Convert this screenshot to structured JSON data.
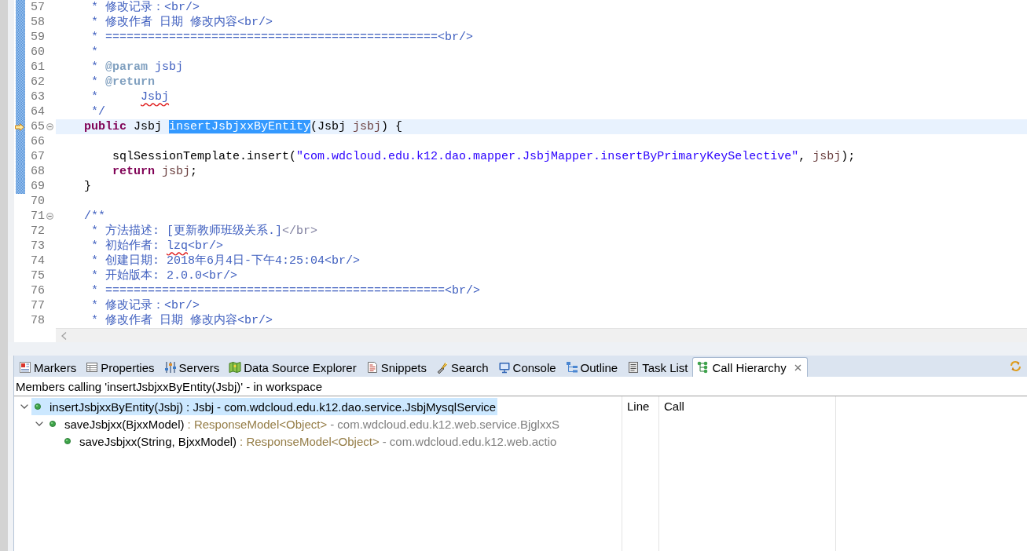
{
  "editor": {
    "lines": [
      {
        "number": "57",
        "changed": true,
        "current": false,
        "fold": false,
        "pointer": false,
        "segments": [
          {
            "kind": "comment",
            "text": "     * 修改记录：<br/>"
          }
        ]
      },
      {
        "number": "58",
        "changed": true,
        "current": false,
        "fold": false,
        "pointer": false,
        "segments": [
          {
            "kind": "comment",
            "text": "     * 修改作者 日期 修改内容<br/>"
          }
        ]
      },
      {
        "number": "59",
        "changed": true,
        "current": false,
        "fold": false,
        "pointer": false,
        "segments": [
          {
            "kind": "comment",
            "text": "     * ===============================================<br/>"
          }
        ]
      },
      {
        "number": "60",
        "changed": true,
        "current": false,
        "fold": false,
        "pointer": false,
        "segments": [
          {
            "kind": "comment",
            "text": "     *"
          }
        ]
      },
      {
        "number": "61",
        "changed": true,
        "current": false,
        "fold": false,
        "pointer": false,
        "segments": [
          {
            "kind": "comment",
            "text": "     * "
          },
          {
            "kind": "doc_tag",
            "text": "@param"
          },
          {
            "kind": "comment",
            "text": " jsbj"
          }
        ]
      },
      {
        "number": "62",
        "changed": true,
        "current": false,
        "fold": false,
        "pointer": false,
        "segments": [
          {
            "kind": "comment",
            "text": "     * "
          },
          {
            "kind": "doc_tag",
            "text": "@return"
          }
        ]
      },
      {
        "number": "63",
        "changed": true,
        "current": false,
        "fold": false,
        "pointer": false,
        "segments": [
          {
            "kind": "comment",
            "text": "     *      "
          },
          {
            "kind": "misspelled",
            "text": "Jsbj"
          }
        ]
      },
      {
        "number": "64",
        "changed": true,
        "current": false,
        "fold": false,
        "pointer": false,
        "segments": [
          {
            "kind": "comment",
            "text": "     */"
          }
        ]
      },
      {
        "number": "65",
        "changed": true,
        "current": true,
        "fold": true,
        "pointer": true,
        "segments": [
          {
            "kind": "keyword",
            "text": "    public"
          },
          {
            "kind": "plain",
            "text": " Jsbj "
          },
          {
            "kind": "selected",
            "text": "insertJsbjxxByEntity"
          },
          {
            "kind": "plain",
            "text": "(Jsbj "
          },
          {
            "kind": "variable",
            "text": "jsbj"
          },
          {
            "kind": "plain",
            "text": ") {"
          }
        ]
      },
      {
        "number": "66",
        "changed": true,
        "current": false,
        "fold": false,
        "pointer": false
      },
      {
        "number": "67",
        "changed": true,
        "current": false,
        "fold": false,
        "pointer": false,
        "segments": [
          {
            "kind": "plain",
            "text": "        sqlSessionTemplate.insert("
          },
          {
            "kind": "string",
            "text": "\"com.wdcloud.edu.k12.dao.mapper.JsbjMapper.insertByPrimaryKeySelective\""
          },
          {
            "kind": "plain",
            "text": ", "
          },
          {
            "kind": "variable",
            "text": "jsbj"
          },
          {
            "kind": "plain",
            "text": ");"
          }
        ]
      },
      {
        "number": "68",
        "changed": true,
        "current": false,
        "fold": false,
        "pointer": false,
        "segments": [
          {
            "kind": "keyword",
            "text": "        return "
          },
          {
            "kind": "variable",
            "text": "jsbj"
          },
          {
            "kind": "plain",
            "text": ";"
          }
        ]
      },
      {
        "number": "69",
        "changed": true,
        "current": false,
        "fold": false,
        "pointer": false,
        "segments": [
          {
            "kind": "plain",
            "text": "    }"
          }
        ]
      },
      {
        "number": "70",
        "changed": false,
        "current": false,
        "fold": false,
        "pointer": false
      },
      {
        "number": "71",
        "changed": false,
        "current": false,
        "fold": true,
        "pointer": false,
        "segments": [
          {
            "kind": "comment",
            "text": "    /**"
          }
        ]
      },
      {
        "number": "72",
        "changed": false,
        "current": false,
        "fold": false,
        "pointer": false,
        "segments": [
          {
            "kind": "comment",
            "text": "     * 方法描述: [更新教师班级关系.]"
          },
          {
            "kind": "html_tag",
            "text": "</br>"
          }
        ]
      },
      {
        "number": "73",
        "changed": false,
        "current": false,
        "fold": false,
        "pointer": false,
        "segments": [
          {
            "kind": "comment",
            "text": "     * 初始作者: "
          },
          {
            "kind": "misspelled",
            "text": "lzq"
          },
          {
            "kind": "comment",
            "text": "<br/>"
          }
        ]
      },
      {
        "number": "74",
        "changed": false,
        "current": false,
        "fold": false,
        "pointer": false,
        "segments": [
          {
            "kind": "comment",
            "text": "     * 创建日期: 2018年6月4日-下午4:25:04<br/>"
          }
        ]
      },
      {
        "number": "75",
        "changed": false,
        "current": false,
        "fold": false,
        "pointer": false,
        "segments": [
          {
            "kind": "comment",
            "text": "     * 开始版本: 2.0.0<br/>"
          }
        ]
      },
      {
        "number": "76",
        "changed": false,
        "current": false,
        "fold": false,
        "pointer": false,
        "segments": [
          {
            "kind": "comment",
            "text": "     * ================================================<br/>"
          }
        ]
      },
      {
        "number": "77",
        "changed": false,
        "current": false,
        "fold": false,
        "pointer": false,
        "segments": [
          {
            "kind": "comment",
            "text": "     * 修改记录：<br/>"
          }
        ]
      },
      {
        "number": "78",
        "changed": false,
        "current": false,
        "fold": false,
        "pointer": false,
        "segments": [
          {
            "kind": "comment",
            "text": "     * 修改作者 日期 修改内容<br/>"
          }
        ]
      }
    ]
  },
  "panel": {
    "tabs": [
      {
        "label": "Markers",
        "selected": false
      },
      {
        "label": "Properties",
        "selected": false
      },
      {
        "label": "Servers",
        "selected": false
      },
      {
        "label": "Data Source Explorer",
        "selected": false
      },
      {
        "label": "Snippets",
        "selected": false
      },
      {
        "label": "Search",
        "selected": false
      },
      {
        "label": "Console",
        "selected": false
      },
      {
        "label": "Outline",
        "selected": false
      },
      {
        "label": "Task List",
        "selected": false
      },
      {
        "label": "Call Hierarchy",
        "selected": true
      }
    ],
    "description": "Members calling 'insertJsbjxxByEntity(Jsbj)' - in workspace",
    "tree": [
      {
        "method": "insertJsbjxxByEntity(Jsbj)",
        "type": ": Jsbj",
        "location": "- com.wdcloud.edu.k12.dao.service.JsbjMysqlService",
        "expanded": true,
        "selected": true,
        "children": [
          {
            "method": "saveJsbjxx(BjxxModel)",
            "type": ": ResponseModel<Object>",
            "location": "- com.wdcloud.edu.k12.web.service.BjglxxS",
            "expanded": true,
            "selected": false,
            "children": [
              {
                "method": "saveJsbjxx(String, BjxxModel)",
                "type": ": ResponseModel<Object>",
                "location": "- com.wdcloud.edu.k12.web.actio",
                "selected": false
              }
            ]
          }
        ]
      }
    ],
    "table": {
      "columns": [
        "Line",
        "Call"
      ]
    }
  }
}
